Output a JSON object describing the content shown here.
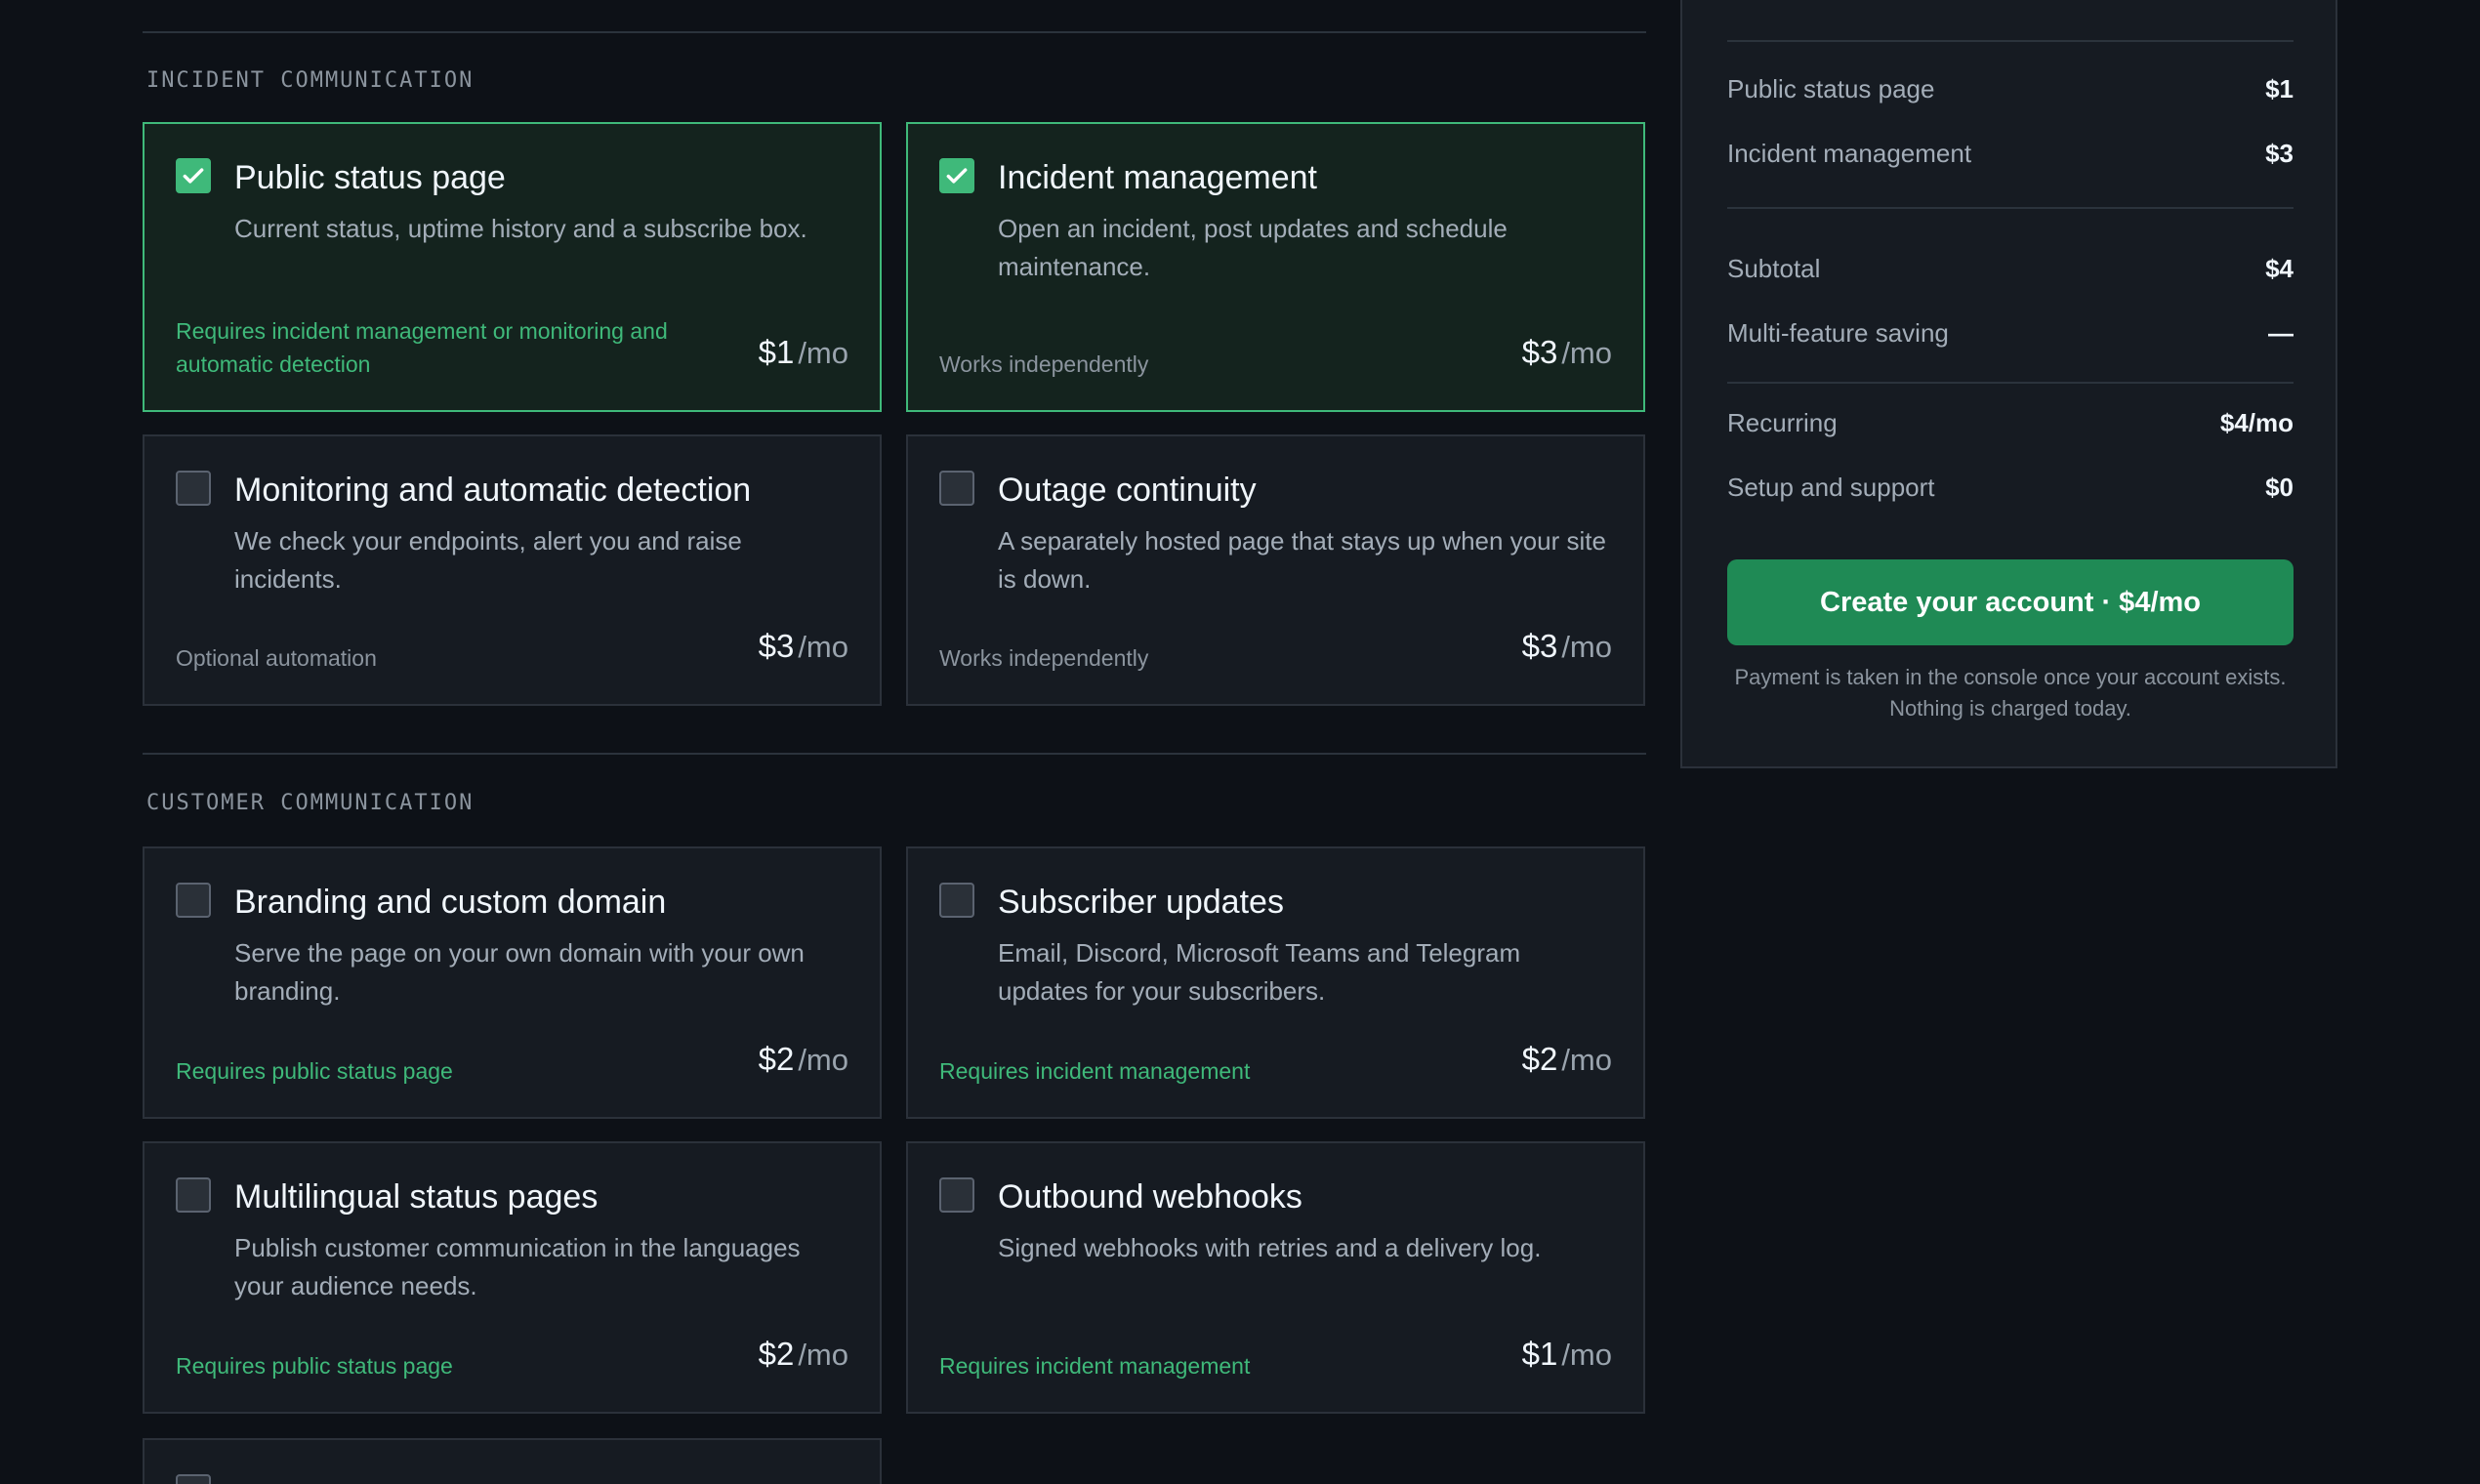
{
  "sections": [
    {
      "title": "INCIDENT COMMUNICATION",
      "features": [
        {
          "title": "Public status page",
          "description": "Current status, uptime history and a subscribe box.",
          "note": "Requires incident management or monitoring and automatic detection",
          "price": "$1",
          "unit": "/mo",
          "selected": true
        },
        {
          "title": "Incident management",
          "description": "Open an incident, post updates and schedule maintenance.",
          "note": "Works independently",
          "price": "$3",
          "unit": "/mo",
          "selected": true
        },
        {
          "title": "Monitoring and automatic detection",
          "description": "We check your endpoints, alert you and raise incidents.",
          "note": "Optional automation",
          "price": "$3",
          "unit": "/mo",
          "selected": false
        },
        {
          "title": "Outage continuity",
          "description": "A separately hosted page that stays up when your site is down.",
          "note": "Works independently",
          "price": "$3",
          "unit": "/mo",
          "selected": false
        }
      ]
    },
    {
      "title": "CUSTOMER COMMUNICATION",
      "features": [
        {
          "title": "Branding and custom domain",
          "description": "Serve the page on your own domain with your own branding.",
          "note": "Requires public status page",
          "price": "$2",
          "unit": "/mo",
          "selected": false
        },
        {
          "title": "Subscriber updates",
          "description": "Email, Discord, Microsoft Teams and Telegram updates for your subscribers.",
          "note": "Requires incident management",
          "price": "$2",
          "unit": "/mo",
          "selected": false
        },
        {
          "title": "Multilingual status pages",
          "description": "Publish customer communication in the languages your audience needs.",
          "note": "Requires public status page",
          "price": "$2",
          "unit": "/mo",
          "selected": false
        },
        {
          "title": "Outbound webhooks",
          "description": "Signed webhooks with retries and a delivery log.",
          "note": "Requires incident management",
          "price": "$1",
          "unit": "/mo",
          "selected": false
        }
      ]
    }
  ],
  "summary": {
    "items": [
      {
        "label": "Public status page",
        "value": "$1"
      },
      {
        "label": "Incident management",
        "value": "$3"
      }
    ],
    "subtotal": {
      "label": "Subtotal",
      "value": "$4"
    },
    "saving": {
      "label": "Multi-feature saving",
      "value": "—"
    },
    "recurring": {
      "label": "Recurring",
      "value": "$4/mo"
    },
    "setup": {
      "label": "Setup and support",
      "value": "$0"
    },
    "cta_label": "Create your account · $4/mo",
    "payment_note": "Payment is taken in the console once your account exists. Nothing is charged today."
  },
  "colors": {
    "accent": "#3fb97a",
    "cta": "#1f8a55",
    "background": "#0d1117",
    "card": "#161b22"
  }
}
